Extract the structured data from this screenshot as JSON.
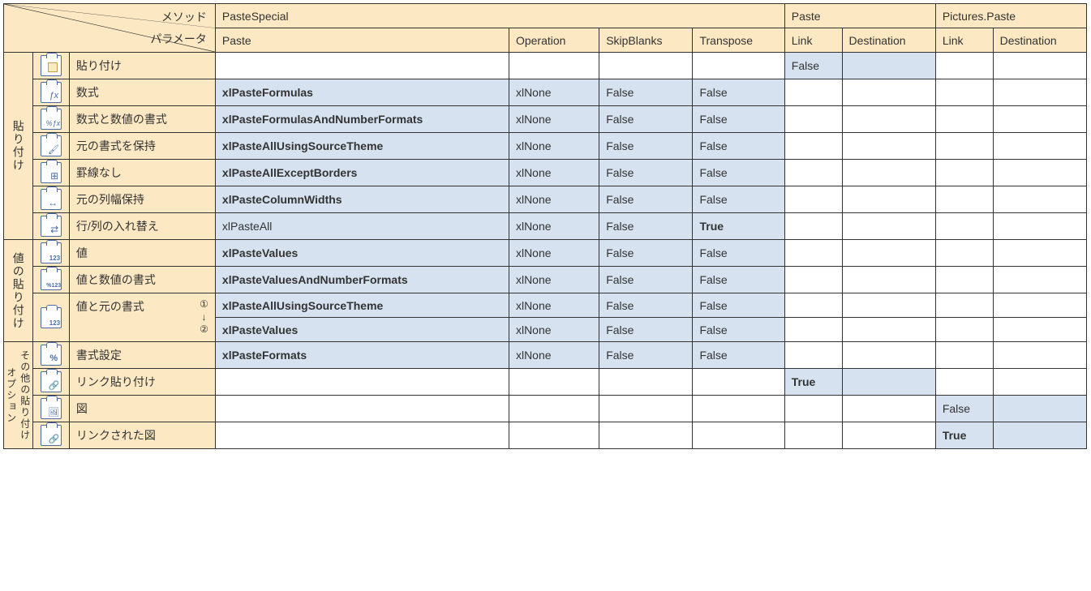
{
  "header": {
    "diag_top": "メソッド",
    "diag_bottom": "パラメータ",
    "methods": [
      "PasteSpecial",
      "Paste",
      "Pictures.Paste"
    ],
    "params_ps": [
      "Paste",
      "Operation",
      "SkipBlanks",
      "Transpose"
    ],
    "params_p": [
      "Link",
      "Destination"
    ],
    "params_pp": [
      "Link",
      "Destination"
    ]
  },
  "groups": {
    "g1": "貼り付け",
    "g2": "値の貼り付け",
    "g3": "その他の貼り付けオプション"
  },
  "rows": {
    "r1": {
      "label": "貼り付け"
    },
    "r2": {
      "label": "数式",
      "paste": "xlPasteFormulas",
      "op": "xlNone",
      "sb": "False",
      "tr": "False"
    },
    "r3": {
      "label": "数式と数値の書式",
      "paste": "xlPasteFormulasAndNumberFormats",
      "op": "xlNone",
      "sb": "False",
      "tr": "False"
    },
    "r4": {
      "label": "元の書式を保持",
      "paste": "xlPasteAllUsingSourceTheme",
      "op": "xlNone",
      "sb": "False",
      "tr": "False"
    },
    "r5": {
      "label": "罫線なし",
      "paste": "xlPasteAllExceptBorders",
      "op": "xlNone",
      "sb": "False",
      "tr": "False"
    },
    "r6": {
      "label": "元の列幅保持",
      "paste": "xlPasteColumnWidths",
      "op": "xlNone",
      "sb": "False",
      "tr": "False"
    },
    "r7": {
      "label": "行/列の入れ替え",
      "paste": "xlPasteAll",
      "op": "xlNone",
      "sb": "False",
      "tr": "True"
    },
    "r8": {
      "label": "値",
      "paste": "xlPasteValues",
      "op": "xlNone",
      "sb": "False",
      "tr": "False"
    },
    "r9": {
      "label": "値と数値の書式",
      "paste": "xlPasteValuesAndNumberFormats",
      "op": "xlNone",
      "sb": "False",
      "tr": "False"
    },
    "r10": {
      "label": "値と元の書式",
      "note1": "①",
      "arrow": "↓",
      "note2": "②",
      "paste": "xlPasteAllUsingSourceTheme",
      "op": "xlNone",
      "sb": "False",
      "tr": "False"
    },
    "r10b": {
      "paste": "xlPasteValues",
      "op": "xlNone",
      "sb": "False",
      "tr": "False"
    },
    "r11": {
      "label": "書式設定",
      "paste": "xlPasteFormats",
      "op": "xlNone",
      "sb": "False",
      "tr": "False"
    },
    "r12": {
      "label": "リンク貼り付け"
    },
    "r13": {
      "label": "図"
    },
    "r14": {
      "label": "リンクされた図"
    }
  },
  "vals": {
    "r1_pLink": "False",
    "r12_pLink": "True",
    "r13_ppLink": "False",
    "r14_ppLink": "True"
  }
}
